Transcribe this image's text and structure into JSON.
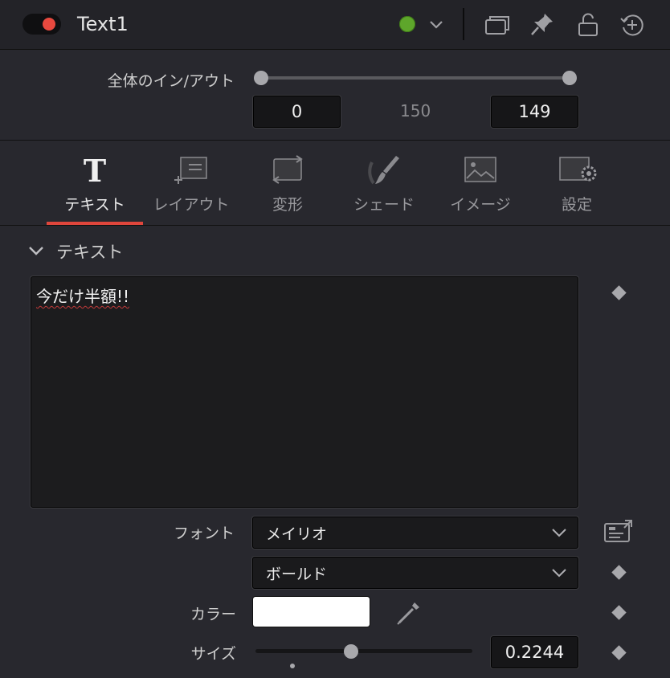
{
  "header": {
    "node_name": "Text1",
    "toggle_color": "#e8493f",
    "status_color": "#5ea62b",
    "icons": [
      "chevron-down-icon",
      "windows-icon",
      "pin-icon",
      "unlock-icon",
      "reset-icon"
    ]
  },
  "inout": {
    "label": "全体のイン/アウト",
    "in_value": "0",
    "mid_value": "150",
    "out_value": "149"
  },
  "tabs": [
    {
      "label": "テキスト",
      "icon": "text-t-icon",
      "active": true
    },
    {
      "label": "レイアウト",
      "icon": "layout-icon",
      "active": false
    },
    {
      "label": "変形",
      "icon": "transform-icon",
      "active": false
    },
    {
      "label": "シェード",
      "icon": "brush-icon",
      "active": false
    },
    {
      "label": "イメージ",
      "icon": "image-icon",
      "active": false
    },
    {
      "label": "設定",
      "icon": "settings-icon",
      "active": false
    }
  ],
  "accent_color": "#e0463c",
  "text_section": {
    "title": "テキスト",
    "content": "今だけ半額!!"
  },
  "font": {
    "label": "フォント",
    "family": "メイリオ",
    "style": "ボールド"
  },
  "color": {
    "label": "カラー",
    "value": "#ffffff"
  },
  "size": {
    "label": "サイズ",
    "value": "0.2244",
    "slider_fraction": 0.44
  }
}
